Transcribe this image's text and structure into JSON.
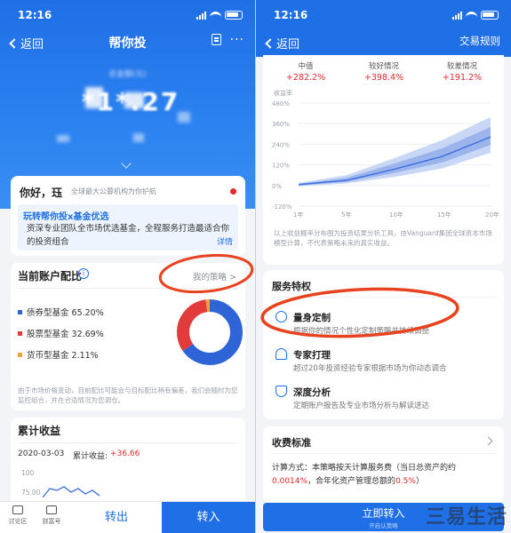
{
  "left": {
    "status_time": "12:16",
    "back_label": "返回",
    "title": "帮你投",
    "more_label": "···",
    "amount_caption": "总金额(元)",
    "amount": "*1*.27",
    "greeting": {
      "title": "你好，珏",
      "subtitle": "全球最大公募机构为你护航",
      "link_title": "玩转帮你投x基金优选",
      "body": "资深专业团队全市场优选基金，全程服务打造最适合你的投资组合",
      "detail": "详情"
    },
    "allocation": {
      "title": "当前账户配比",
      "strategy_link": "我的策略 >",
      "legend": [
        {
          "label": "债券型基金 65.20%",
          "value": 65.2,
          "color": "#2f64d8"
        },
        {
          "label": "股票型基金 32.69%",
          "value": 32.69,
          "color": "#e23b3b"
        },
        {
          "label": "货币型基金 2.11%",
          "value": 2.11,
          "color": "#f0a13a"
        }
      ],
      "note": "由于市场价格变动，目前配比可能会与目标配比稍有偏差，我们会随时为您监控组合，并在合适情况为您调仓。"
    },
    "earnings": {
      "title": "累计收益",
      "date": "2020-03-03",
      "label": "累计收益:",
      "value": "+36.66",
      "ticks": [
        "100",
        "75.00"
      ]
    },
    "bottom": {
      "forum": "讨论区",
      "wealth": "财富号",
      "sell": "转出",
      "buy": "转入"
    }
  },
  "right": {
    "status_time": "12:16",
    "back_label": "返回",
    "rules_label": "交易规则",
    "stats": [
      {
        "label": "中值",
        "value": "+282.2%"
      },
      {
        "label": "较好情况",
        "value": "+398.4%"
      },
      {
        "label": "较差情况",
        "value": "+191.2%"
      }
    ],
    "y_title": "收益率",
    "note": "以上收益概率分布图为投资结果分析工具，由Vanguard集团全球资本市场模型计算，不代表策略未来的真实收益。",
    "services": {
      "title": "服务特权",
      "items": [
        {
          "name": "量身定制",
          "desc": "根据你的情况个性化定制策略并持续调整"
        },
        {
          "name": "专家打理",
          "desc": "超过20年投资经验专家根据市场为你动态调合"
        },
        {
          "name": "深度分析",
          "desc": "定期账户报告及专业市场分析与解读送达"
        }
      ]
    },
    "fee": {
      "title": "收费标准",
      "prefix": "计算方式：本策略按天计算服务费（当日总资产的约",
      "rate_daily": "0.0014%",
      "middle": "，合年化资产管理总额的",
      "rate_year": "0.5%",
      "suffix": "）"
    },
    "cta": {
      "label": "立即转入",
      "sub": "开启认策略"
    },
    "watermark": "三易生活"
  },
  "chart_data": {
    "type": "area",
    "x": [
      "1年",
      "5年",
      "10年",
      "15年",
      "20年"
    ],
    "ylim": [
      -120,
      480
    ],
    "yticks": [
      "480%",
      "360%",
      "240%",
      "120%",
      "0%",
      "-120%"
    ],
    "series": [
      {
        "values": [
          5,
          30,
          95,
          170,
          282
        ]
      },
      {
        "values": [
          15,
          60,
          160,
          265,
          398
        ]
      },
      {
        "values": [
          -5,
          12,
          50,
          100,
          191
        ]
      }
    ]
  }
}
